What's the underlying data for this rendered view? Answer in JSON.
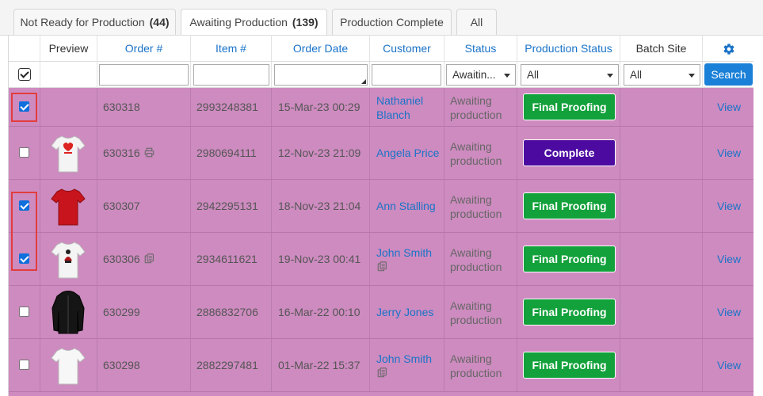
{
  "tabs": [
    {
      "label": "Not Ready for Production",
      "count": "(44)"
    },
    {
      "label": "Awaiting Production",
      "count": "(139)"
    },
    {
      "label": "Production Complete",
      "count": ""
    },
    {
      "label": "All",
      "count": ""
    }
  ],
  "columns": {
    "preview": "Preview",
    "order": "Order #",
    "item": "Item #",
    "order_date": "Order Date",
    "customer": "Customer",
    "status": "Status",
    "production_status": "Production Status",
    "batch_site": "Batch Site"
  },
  "filters": {
    "status_value": "Awaitin...",
    "production_status_value": "All",
    "batch_site_value": "All",
    "search_label": "Search"
  },
  "rows": [
    {
      "order": "630318",
      "item": "2993248381",
      "date": "15-Mar-23 00:29",
      "customer_line1": "Nathaniel",
      "customer_line2": "Blanch",
      "status_line1": "Awaiting",
      "status_line2": "production",
      "production": "Final Proofing",
      "view": "View"
    },
    {
      "order": "630316",
      "item": "2980694111",
      "date": "12-Nov-23 21:09",
      "customer_line1": "Angela Price",
      "customer_line2": "",
      "status_line1": "Awaiting",
      "status_line2": "production",
      "production": "Complete",
      "view": "View"
    },
    {
      "order": "630307",
      "item": "2942295131",
      "date": "18-Nov-23 21:04",
      "customer_line1": "Ann Stalling",
      "customer_line2": "",
      "status_line1": "Awaiting",
      "status_line2": "production",
      "production": "Final Proofing",
      "view": "View"
    },
    {
      "order": "630306",
      "item": "2934611621",
      "date": "19-Nov-23 00:41",
      "customer_line1": "John Smith",
      "customer_line2": "",
      "status_line1": "Awaiting",
      "status_line2": "production",
      "production": "Final Proofing",
      "view": "View"
    },
    {
      "order": "630299",
      "item": "2886832706",
      "date": "16-Mar-22 00:10",
      "customer_line1": "Jerry Jones",
      "customer_line2": "",
      "status_line1": "Awaiting",
      "status_line2": "production",
      "production": "Final Proofing",
      "view": "View"
    },
    {
      "order": "630298",
      "item": "2882297481",
      "date": "01-Mar-22 15:37",
      "customer_line1": "John Smith",
      "customer_line2": "",
      "status_line1": "Awaiting",
      "status_line2": "production",
      "production": "Final Proofing",
      "view": "View"
    }
  ],
  "icons": {
    "settings": "gear-icon",
    "print": "printer-icon",
    "copy": "copy-icon"
  },
  "colors": {
    "row_highlight": "#cd8bbf",
    "final_proofing": "#12a13a",
    "complete": "#4d0aa1",
    "link": "#1a73c8",
    "selection_outline": "#e23d3d"
  }
}
